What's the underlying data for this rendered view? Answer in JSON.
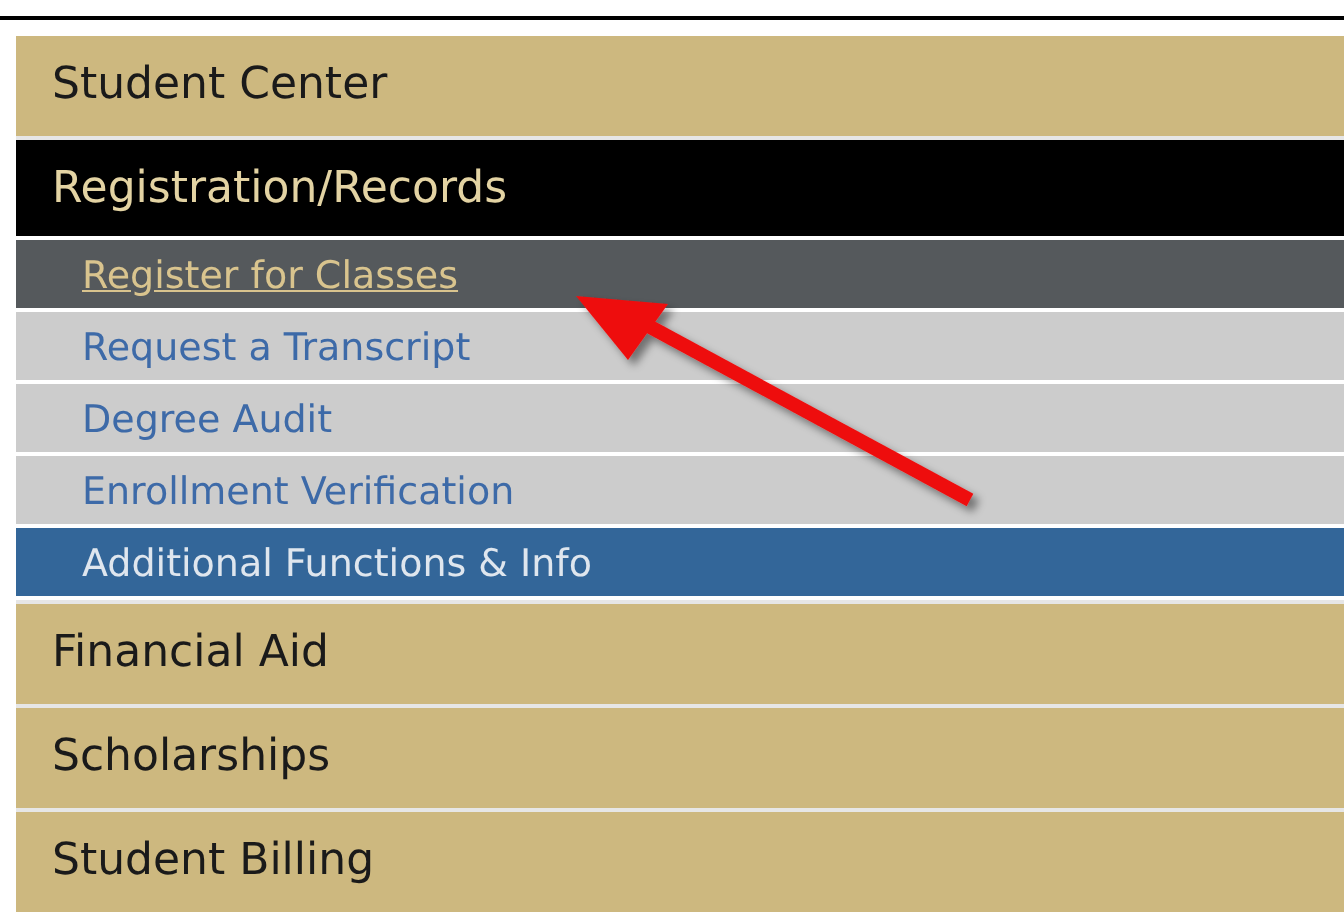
{
  "menu": [
    {
      "label": "Student Center",
      "expanded": false
    },
    {
      "label": "Registration/Records",
      "expanded": true,
      "children": [
        {
          "label": "Register for Classes",
          "kind": "link",
          "selected": true
        },
        {
          "label": "Request a Transcript",
          "kind": "link",
          "selected": false
        },
        {
          "label": "Degree Audit",
          "kind": "link",
          "selected": false
        },
        {
          "label": "Enrollment Verification",
          "kind": "link",
          "selected": false
        },
        {
          "label": "Additional Functions & Info",
          "kind": "more",
          "selected": false
        }
      ]
    },
    {
      "label": "Financial Aid",
      "expanded": false
    },
    {
      "label": "Scholarships",
      "expanded": false
    },
    {
      "label": "Student Billing",
      "expanded": false
    }
  ]
}
